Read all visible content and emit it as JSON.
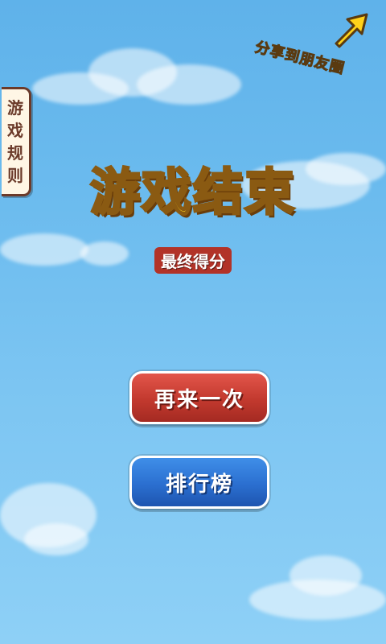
{
  "rules_tab": {
    "label_chars": [
      "游",
      "戏",
      "规",
      "则"
    ]
  },
  "share": {
    "label": "分享到朋友圈",
    "icon": "arrow-up-right-icon"
  },
  "title": "游戏结束",
  "subtitle": "最终得分",
  "score": "",
  "buttons": {
    "replay": "再来一次",
    "leaderboard": "排行榜"
  },
  "colors": {
    "sky": "#6bbbee",
    "title_yellow": "#ffd21a",
    "replay_red": "#c2392e",
    "rank_blue": "#2b6fd0",
    "rules_brown": "#6b3a2a"
  }
}
